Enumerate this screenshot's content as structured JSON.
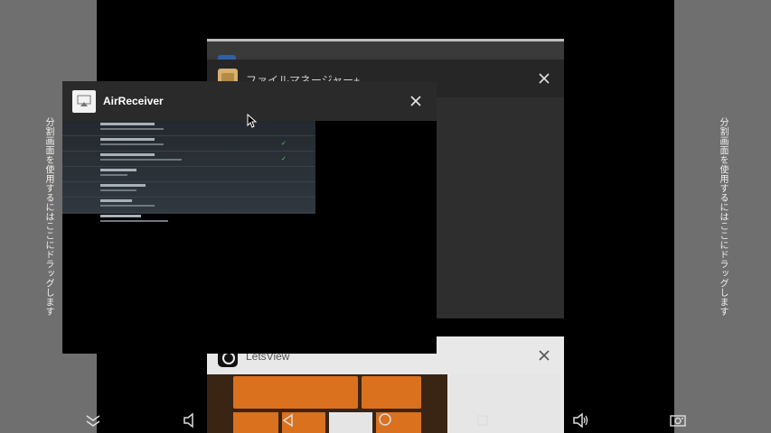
{
  "split_hint": "分割画面を使用するにはここにドラッグします",
  "cards": {
    "file_manager": {
      "title": "ファイルマネージャー+"
    },
    "airreceiver": {
      "title": "AirReceiver"
    },
    "letsview": {
      "title": "LetsView"
    }
  },
  "icons": {
    "close": "close-icon",
    "collapse": "chevron-double-down-icon",
    "volume_down": "volume-down-icon",
    "back": "back-icon",
    "home": "home-icon",
    "recents": "recents-icon",
    "volume_up": "volume-up-icon",
    "screenshot": "camera-icon"
  },
  "colors": {
    "side_zone": "#6f6f6f",
    "card_header_dark": "#2a2a2a",
    "letsview_header": "#e8e8e8",
    "letsview_orange": "#d9711f"
  }
}
